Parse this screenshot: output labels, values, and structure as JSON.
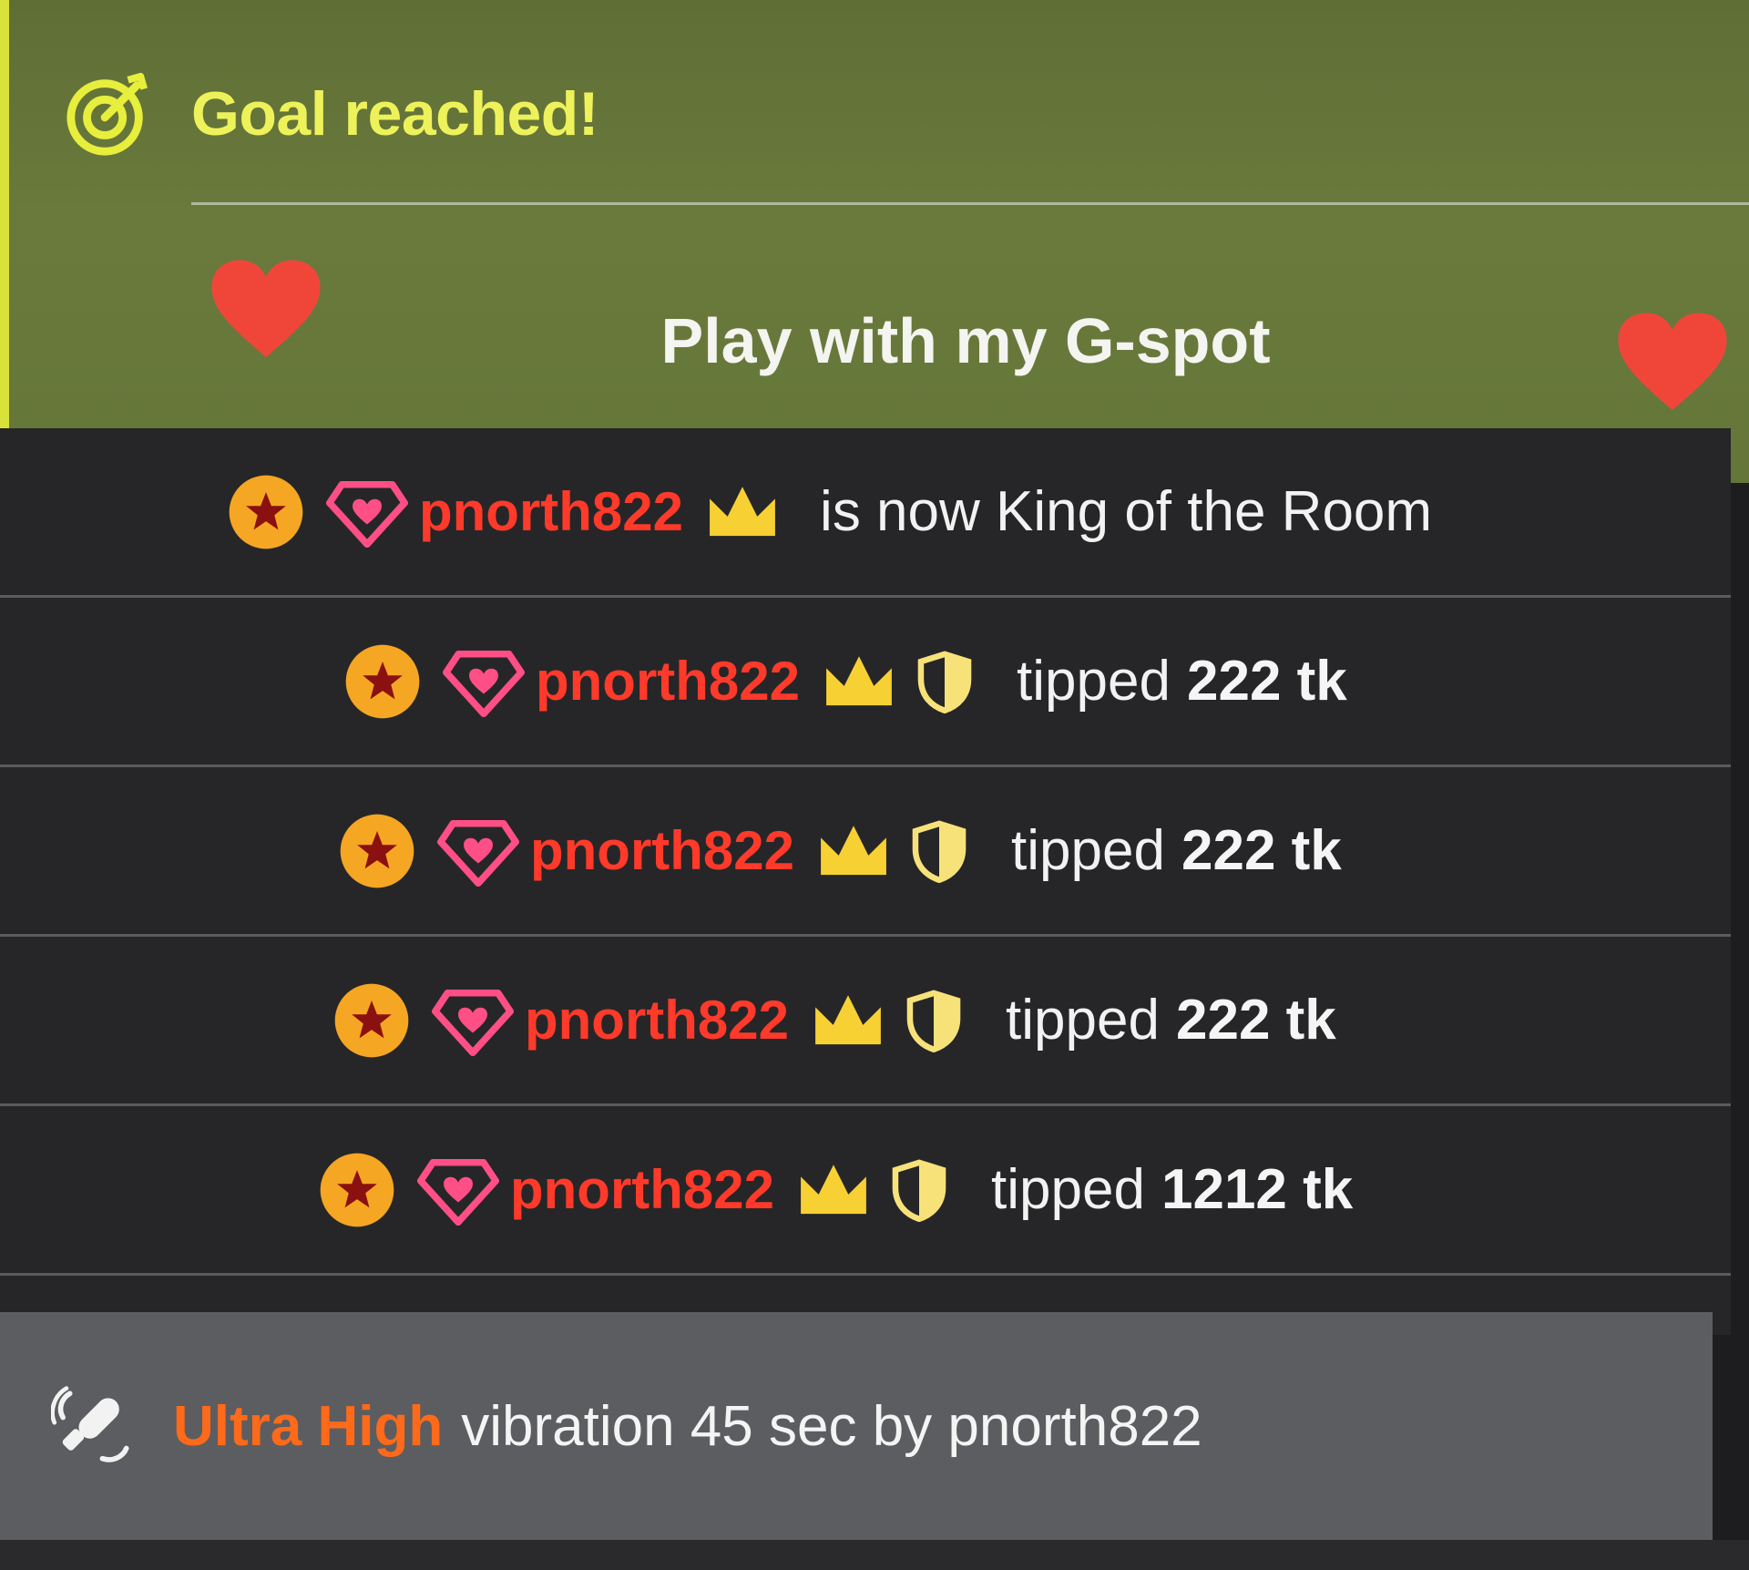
{
  "goal": {
    "title": "Goal reached!",
    "text": "Play with my G-spot",
    "heart_color": "#f0463a",
    "accent": "#eef25a"
  },
  "feed": [
    {
      "user": "pnorth822",
      "action": "is now King of the Room",
      "amount": "",
      "badges": [
        "star-icon",
        "gem-icon",
        "crown-icon"
      ]
    },
    {
      "user": "pnorth822",
      "action": "tipped",
      "amount": "222 tk",
      "badges": [
        "star-icon",
        "gem-icon",
        "crown-icon",
        "shield-icon"
      ]
    },
    {
      "user": "pnorth822",
      "action": "tipped",
      "amount": "222 tk",
      "badges": [
        "star-icon",
        "gem-icon",
        "crown-icon",
        "shield-icon"
      ]
    },
    {
      "user": "pnorth822",
      "action": "tipped",
      "amount": "222 tk",
      "badges": [
        "star-icon",
        "gem-icon",
        "crown-icon",
        "shield-icon"
      ]
    },
    {
      "user": "pnorth822",
      "action": "tipped",
      "amount": "1212 tk",
      "badges": [
        "star-icon",
        "gem-icon",
        "crown-icon",
        "shield-icon"
      ]
    }
  ],
  "vibration": {
    "level": "Ultra High",
    "text": "vibration 45 sec by pnorth822",
    "icon": "vibrator-icon"
  },
  "colors": {
    "username": "#ff3a2a",
    "star_badge": "#f5a623",
    "gem_badge": "#ff4f86",
    "crown": "#f7d034",
    "vibe_level": "#ff6a1a"
  }
}
